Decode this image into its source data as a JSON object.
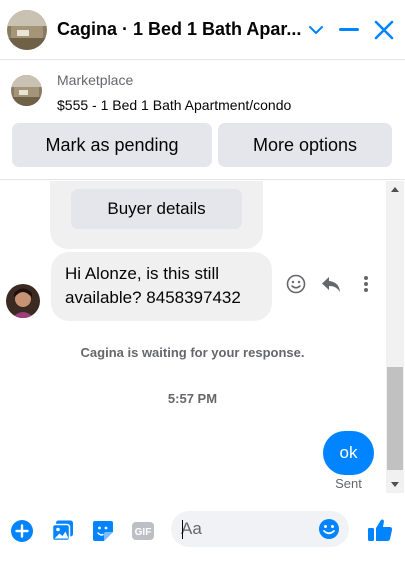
{
  "header": {
    "title": "Cagina · 1 Bed 1 Bath Apar...",
    "icons": [
      "chevron-down-icon",
      "minimize-icon",
      "close-icon"
    ]
  },
  "listing": {
    "label": "Marketplace",
    "title": "$555 - 1 Bed 1 Bath Apartment/condo",
    "buttons": {
      "mark_pending": "Mark as pending",
      "more_options": "More options"
    }
  },
  "conversation": {
    "buyer_details": "Buyer details",
    "incoming_message": "Hi Alonze, is this still available? 8458397432",
    "waiting_notice": "Cagina is waiting for your response.",
    "timestamp": "5:57 PM",
    "outgoing_message": "ok",
    "status": "Sent"
  },
  "composer": {
    "placeholder": "Aa",
    "gif_label": "GIF"
  },
  "colors": {
    "accent": "#0084ff",
    "bubble_gray": "#f0f0f0",
    "button_gray": "#e4e6eb",
    "muted_text": "#65676b"
  }
}
